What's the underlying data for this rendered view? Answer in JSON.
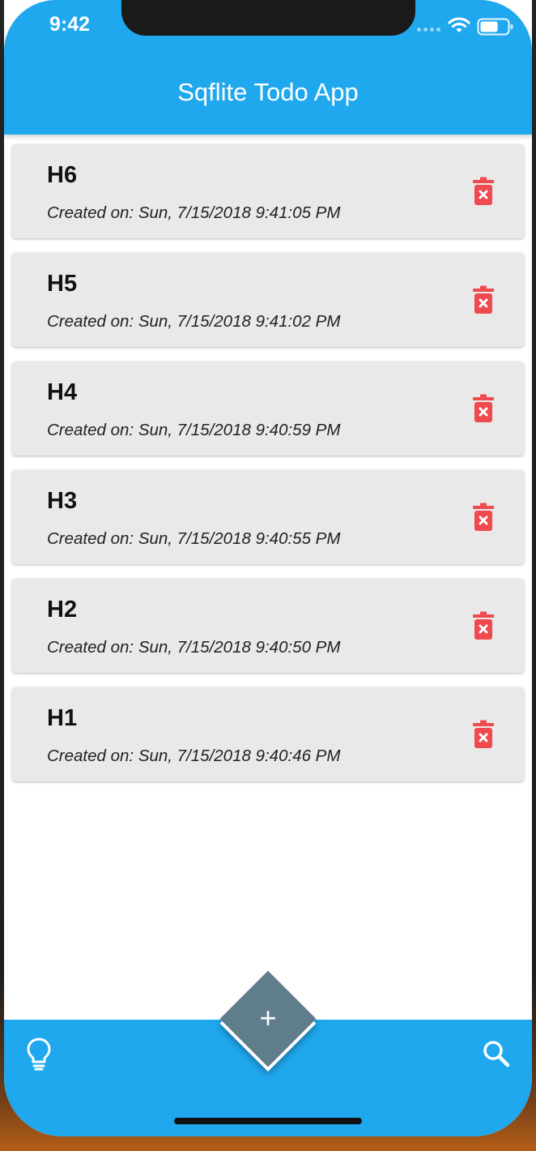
{
  "status_bar": {
    "time": "9:42"
  },
  "app_bar": {
    "title": "Sqflite Todo App"
  },
  "todos": [
    {
      "title": "H6",
      "created": "Created on: Sun, 7/15/2018 9:41:05 PM"
    },
    {
      "title": "H5",
      "created": "Created on: Sun, 7/15/2018 9:41:02 PM"
    },
    {
      "title": "H4",
      "created": "Created on: Sun, 7/15/2018 9:40:59 PM"
    },
    {
      "title": "H3",
      "created": "Created on: Sun, 7/15/2018 9:40:55 PM"
    },
    {
      "title": "H2",
      "created": "Created on: Sun, 7/15/2018 9:40:50 PM"
    },
    {
      "title": "H1",
      "created": "Created on: Sun, 7/15/2018 9:40:46 PM"
    }
  ],
  "fab": {
    "label": "+"
  },
  "bottom_bar": {
    "left_icon": "lightbulb-icon",
    "right_icon": "search-icon"
  },
  "colors": {
    "primary": "#1fa8ee",
    "card": "#e9e9e9",
    "delete": "#f0494e",
    "fab": "#607d8b"
  }
}
